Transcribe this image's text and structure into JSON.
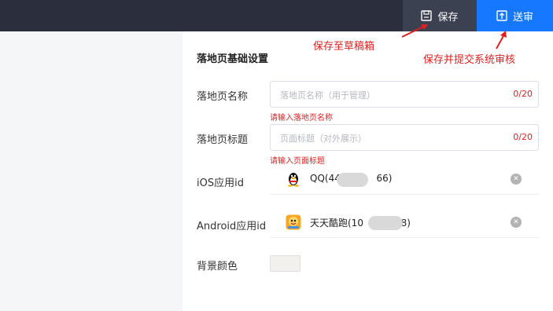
{
  "toolbar": {
    "save_label": "保存",
    "submit_label": "送审"
  },
  "annotations": {
    "save": "保存至草稿箱",
    "submit": "保存并提交系统审核"
  },
  "form": {
    "section_title": "落地页基础设置",
    "name": {
      "label": "落地页名称",
      "placeholder": "落地页名称（用于管理）",
      "counter": "0/20",
      "error": "请输入落地页名称"
    },
    "title": {
      "label": "落地页标题",
      "placeholder": "页面标题（对外展示）",
      "counter": "0/20",
      "error": "请输入页面标题"
    },
    "ios_app": {
      "label": "iOS应用id",
      "name_start": "QQ(44",
      "name_end": "66)",
      "icon": "qq-penguin-icon"
    },
    "android_app": {
      "label": "Android应用id",
      "name_start": "天天酷跑(10",
      "name_end": "8)",
      "icon": "game-app-icon"
    },
    "bg_color": {
      "label": "背景颜色",
      "value": "#f3f1ee"
    }
  },
  "colors": {
    "topbar": "#2b2f3d",
    "save_button": "#3b4150",
    "submit_button": "#1677ff",
    "error": "#e02020"
  }
}
